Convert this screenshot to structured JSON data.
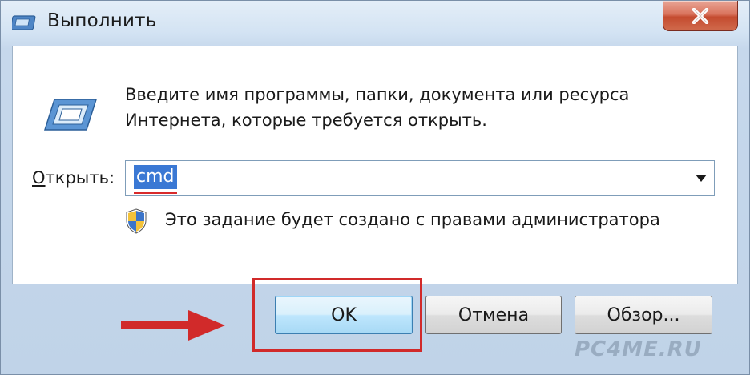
{
  "window": {
    "title": "Выполнить",
    "close_glyph": "✕"
  },
  "content": {
    "description_line1": "Введите имя программы, папки, документа или ресурса",
    "description_line2": "Интернета, которые требуется открыть.",
    "open_label_prefix": "",
    "open_label_accel": "О",
    "open_label_rest": "ткрыть:",
    "open_value": "cmd",
    "admin_notice": "Это задание будет создано с правами администратора"
  },
  "buttons": {
    "ok": "OK",
    "cancel": "Отмена",
    "browse": "Обзор..."
  },
  "watermark": "PC4ME.RU",
  "icons": {
    "title": "run-icon",
    "dialog": "run-icon",
    "shield": "uac-shield-icon",
    "dropdown": "chevron-down-icon",
    "close": "close-icon",
    "annotation": "red-arrow-icon"
  },
  "colors": {
    "selection": "#3a78d4",
    "annotation_red": "#d12a2a",
    "close_button": "#c44b2f"
  }
}
